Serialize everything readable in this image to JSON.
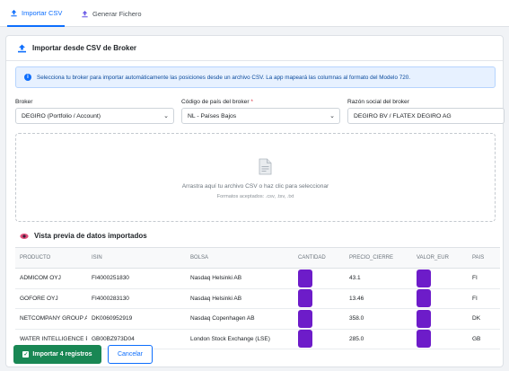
{
  "tabs": [
    {
      "label": "Importar CSV",
      "icon": "upload-icon",
      "active": true
    },
    {
      "label": "Generar Fichero",
      "icon": "file-icon",
      "active": false
    }
  ],
  "card": {
    "title": "Importar desde CSV de Broker",
    "alert": "Selecciona tu broker para importar automáticamente las posiciones desde un archivo CSV. La app mapeará las columnas al formato del Modelo 720."
  },
  "form": {
    "broker_label": "Broker",
    "broker_value": "DEGIRO (Portfolio / Account)",
    "country_label": "Código de país del broker",
    "country_required": "*",
    "country_value": "NL - Países Bajos",
    "name_label": "Razón social del broker",
    "name_value": "DEGIRO BV / FLATEX DEGIRO AG"
  },
  "dropzone": {
    "text": "Arrastra aquí tu archivo CSV o haz clic para seleccionar",
    "formats": "Formatos aceptados: .csv, .tsv, .txt"
  },
  "preview": {
    "title": "Vista previa de datos importados",
    "columns": [
      "PRODUCTO",
      "ISIN",
      "BOLSA",
      "CANTIDAD",
      "PRECIO_CIERRE",
      "VALOR_EUR",
      "PAIS"
    ],
    "rows": [
      {
        "producto": "ADMICOM OYJ",
        "isin": "FI4000251830",
        "bolsa": "Nasdaq Helsinki AB",
        "precio": "43.1",
        "pais": "FI"
      },
      {
        "producto": "GOFORE OYJ",
        "isin": "FI4000283130",
        "bolsa": "Nasdaq Helsinki AB",
        "precio": "13.46",
        "pais": "FI"
      },
      {
        "producto": "NETCOMPANY GROUP A/S",
        "isin": "DK0060952919",
        "bolsa": "Nasdaq Copenhagen AB",
        "precio": "358.0",
        "pais": "DK"
      },
      {
        "producto": "WATER INTELLIGENCE PLC",
        "isin": "GB00BZ973D04",
        "bolsa": "London Stock Exchange (LSE)",
        "precio": "285.0",
        "pais": "GB"
      }
    ]
  },
  "actions": {
    "import_label": "Importar 4 registros",
    "cancel_label": "Cancelar"
  },
  "colors": {
    "primary": "#0d6efd",
    "success": "#198754",
    "redaction": "#6d1cc9"
  }
}
